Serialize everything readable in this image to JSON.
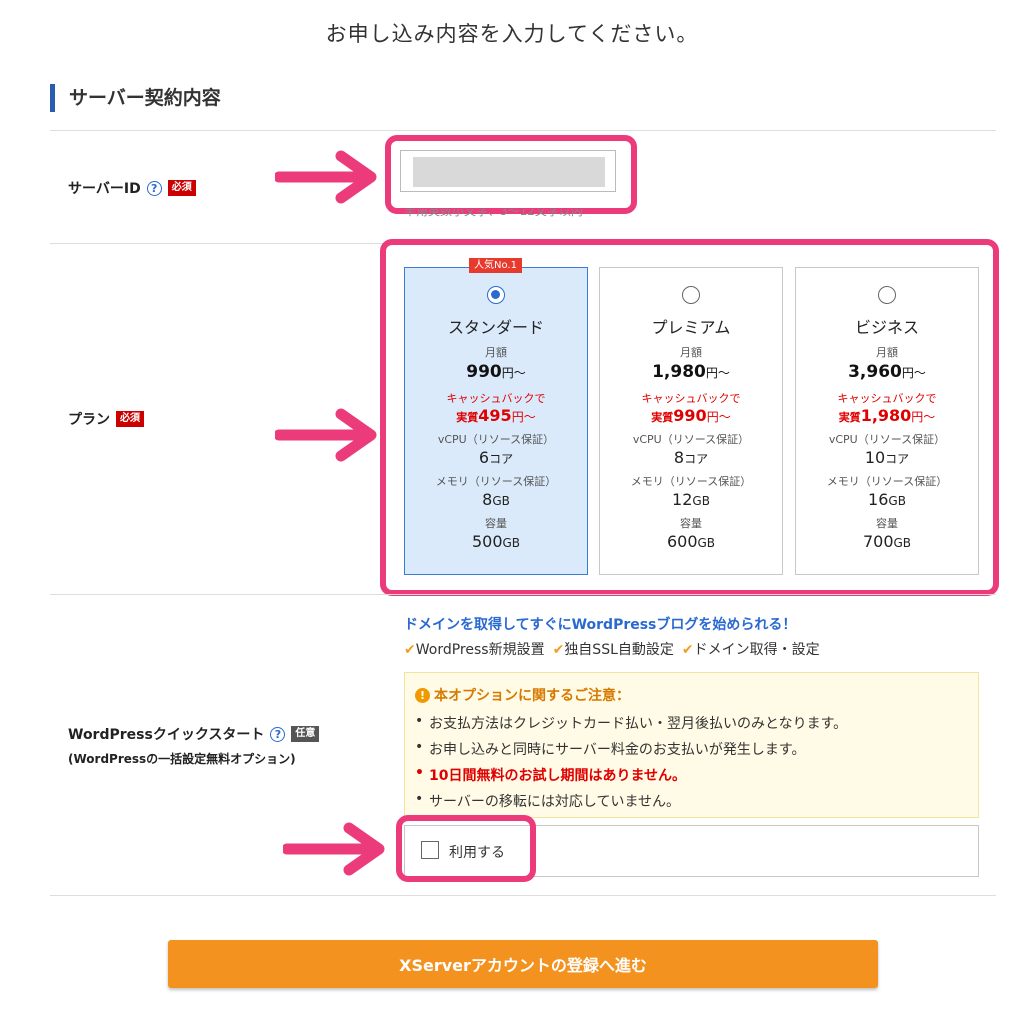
{
  "page": {
    "title": "お申し込み内容を入力してください。"
  },
  "section": {
    "heading": "サーバー契約内容"
  },
  "server_id": {
    "label": "サーバーID",
    "required_badge": "必須",
    "hint": "半角英数小文字、3～12文字以内",
    "value": ""
  },
  "plan": {
    "label": "プラン",
    "required_badge": "必須",
    "popular_badge": "人気No.1",
    "monthly_label": "月額",
    "cashback_label": "キャッシュバックで",
    "actual_label": "実質",
    "yen_suffix": "円～",
    "vcpu_label": "vCPU（リソース保証）",
    "memory_label": "メモリ（リソース保証）",
    "storage_label": "容量",
    "core_unit": "コア",
    "gb_unit": "GB",
    "selected": "standard",
    "cards": [
      {
        "name": "スタンダード",
        "price": "990",
        "cb_price": "495",
        "vcpu": "6",
        "memory": "8",
        "storage": "500"
      },
      {
        "name": "プレミアム",
        "price": "1,980",
        "cb_price": "990",
        "vcpu": "8",
        "memory": "12",
        "storage": "600"
      },
      {
        "name": "ビジネス",
        "price": "3,960",
        "cb_price": "1,980",
        "vcpu": "10",
        "memory": "16",
        "storage": "700"
      }
    ]
  },
  "quick_start": {
    "label": "WordPressクイックスタート",
    "optional_badge": "任意",
    "sublabel": "(WordPressの一括設定無料オプション)",
    "heading": "ドメインを取得してすぐにWordPressブログを始められる！",
    "features": [
      "WordPress新規設置",
      "独自SSL自動設定",
      "ドメイン取得・設定"
    ],
    "notice_title": "本オプションに関するご注意：",
    "notices": [
      "お支払方法はクレジットカード払い・翌月後払いのみとなります。",
      "お申し込みと同時にサーバー料金のお支払いが発生します。",
      "10日間無料のお試し期間はありません。",
      "サーバーの移転には対応していません。"
    ],
    "use_label": "利用する",
    "checked": false
  },
  "submit": {
    "label": "XServerアカウントの登録へ進む"
  },
  "colors": {
    "accent": "#ec3b7a",
    "submit": "#f4921f",
    "link_blue": "#2a6ad0",
    "required_red": "#cc0000"
  }
}
